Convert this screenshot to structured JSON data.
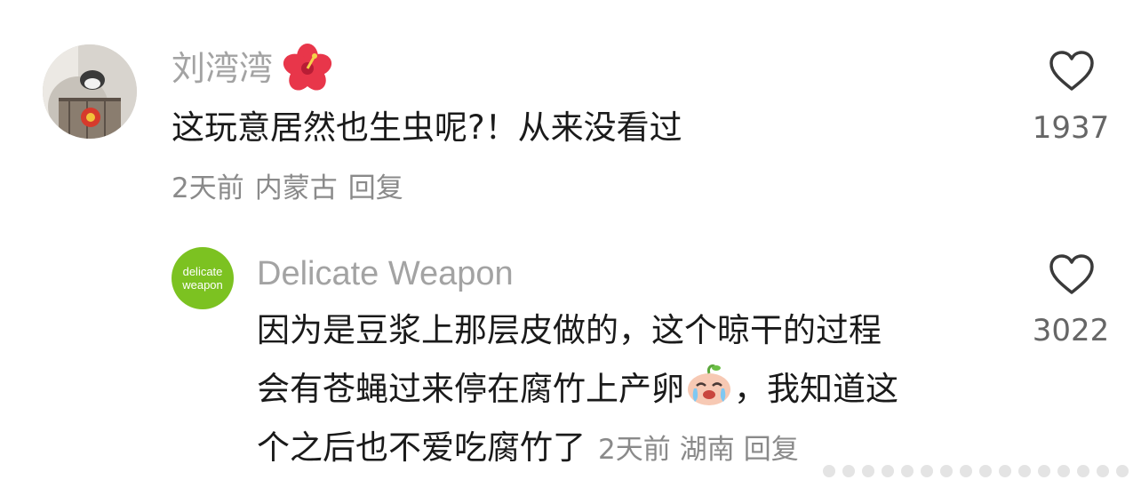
{
  "comment": {
    "username": "刘湾湾",
    "username_emoji": "hibiscus-emoji",
    "text": "这玩意居然也生虫呢?！从来没看过",
    "time": "2天前",
    "location": "内蒙古",
    "reply_label": "回复",
    "likes": "1937"
  },
  "reply": {
    "avatar_text_line1": "delicate",
    "avatar_text_line2": "weapon",
    "avatar_color": "#7cc221",
    "username": "Delicate Weapon",
    "text_line1": "因为是豆浆上那层皮做的，这个晾干的过程",
    "text_line2_part1": "会有苍蝇过来停在腐竹上产卵",
    "text_line2_emoji": "crying-face-emoji",
    "text_line2_part2": "，我知道这",
    "text_line3": "个之后也不爱吃腐竹了",
    "time": "2天前",
    "location": "湖南",
    "reply_label": "回复",
    "likes": "3022"
  }
}
